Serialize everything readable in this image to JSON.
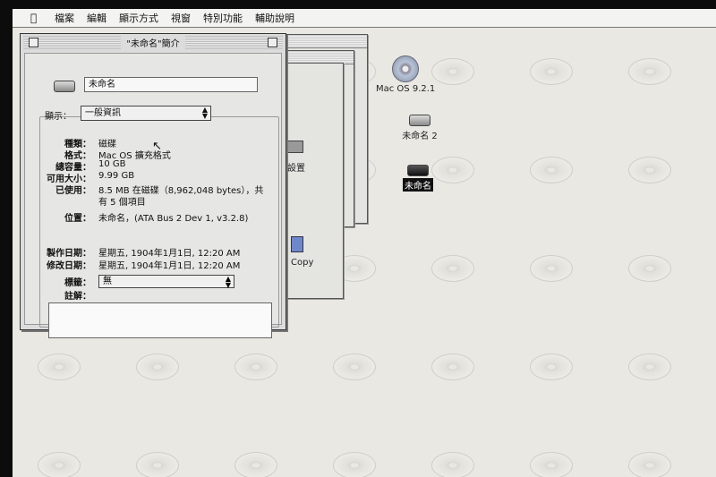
{
  "menubar": {
    "apple_icon": "apple-icon",
    "items": [
      "檔案",
      "編輯",
      "顯示方式",
      "視窗",
      "特別功能",
      "輔助說明"
    ]
  },
  "desktop": {
    "icons": [
      {
        "label": "Mac OS 9.2.1",
        "icon": "cd-icon",
        "selected": false
      },
      {
        "label": "未命名 2",
        "icon": "hard-drive-icon",
        "selected": false
      },
      {
        "label": "未命名",
        "icon": "hard-drive-icon",
        "selected": true
      }
    ],
    "partial_labels": {
      "settings": "設置",
      "copy": "Copy"
    }
  },
  "info_window": {
    "title": "\"未命名\"簡介",
    "name_field": "未命名",
    "show_label": "顯示：",
    "show_value": "一般資訊",
    "fields": [
      {
        "label": "種類：",
        "value": "磁碟"
      },
      {
        "label": "格式：",
        "value": "Mac OS 擴充格式"
      },
      {
        "label": "總容量：",
        "value": "10 GB"
      },
      {
        "label": "可用大小：",
        "value": "9.99 GB"
      },
      {
        "label": "已使用：",
        "value": "8.5 MB 在磁碟（8,962,048 bytes），共",
        "value2": "有 5 個項目"
      },
      {
        "label": "位置：",
        "value": "未命名，(ATA Bus 2 Dev 1, v3.2.8)"
      }
    ],
    "created_label": "製作日期：",
    "created_value": "星期五, 1904年1月1日, 12:20 AM",
    "modified_label": "修改日期：",
    "modified_value": "星期五, 1904年1月1日, 12:20 AM",
    "tag_label": "標籤：",
    "tag_value": "無",
    "comment_label": "註解："
  }
}
